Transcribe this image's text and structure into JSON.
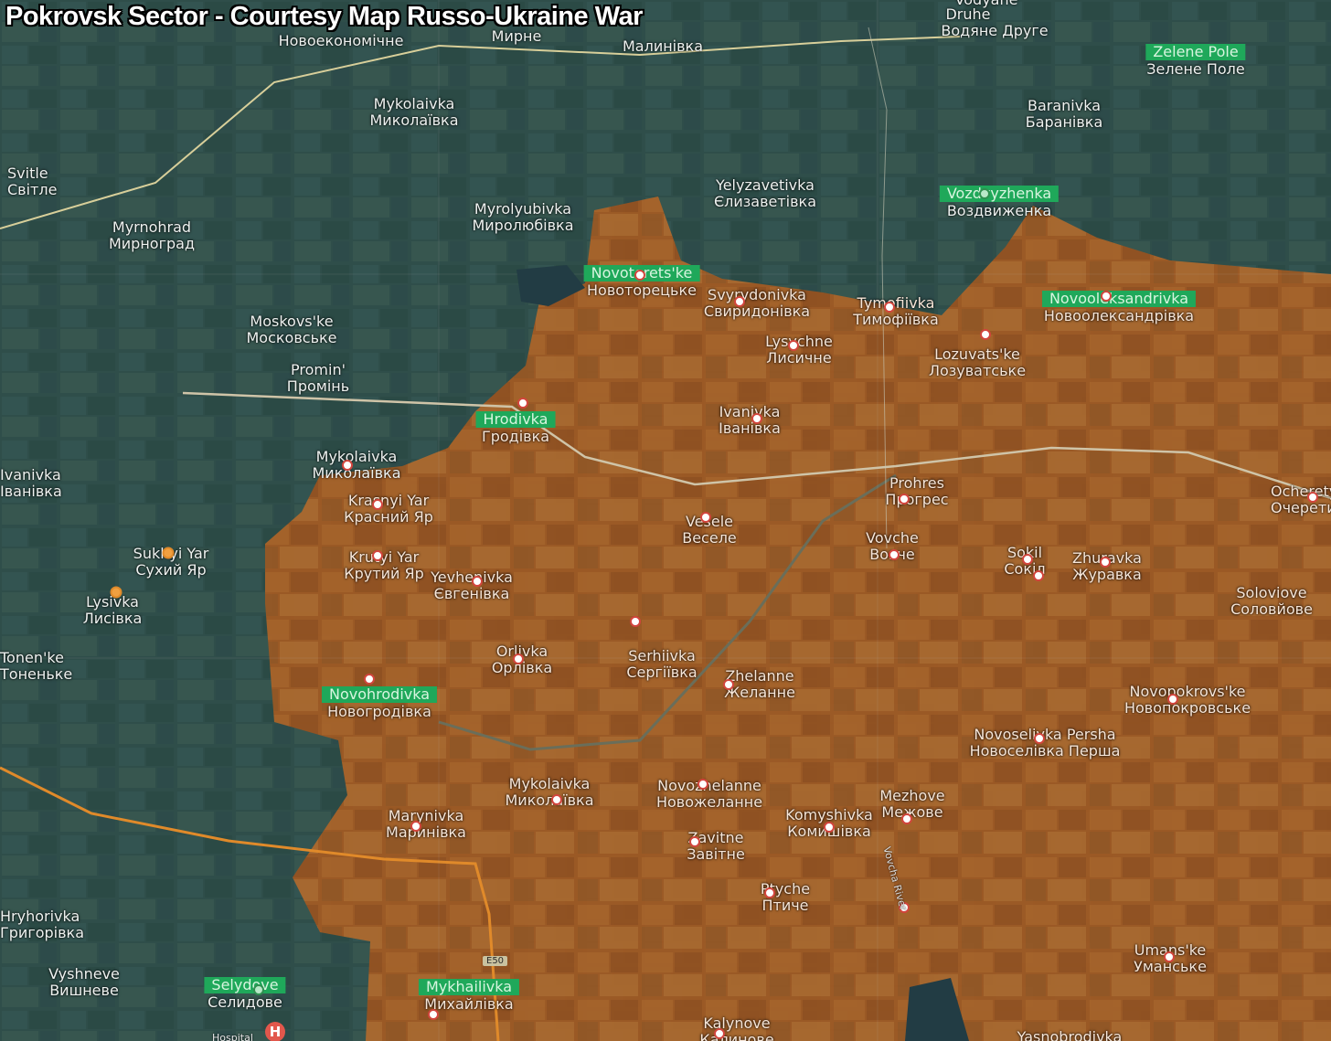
{
  "title": "Pokrovsk Sector - Courtesy Map Russo-Ukraine War",
  "colors": {
    "occupied_overlay": "#c46a1e",
    "ukraine_area": "#2f4f45",
    "highlight_label": "#1fa85a",
    "road_major": "#e9d9a6",
    "road_e50": "#e08a2a"
  },
  "road_shield": "E50",
  "river_label": "Vovcha River",
  "hospital_label": "Hospital",
  "hospital_icon": "hospital-icon",
  "top_cut_labels": [
    "Vodyane",
    "Druhe",
    "Водяне Друге",
    "Малинівка",
    "Новоекономічне",
    "Мирне"
  ],
  "places": [
    {
      "lat": "Zelene Pole",
      "cyr": "Зелене Поле",
      "highlight": true
    },
    {
      "lat": "Baranivka",
      "cyr": "Баранівка"
    },
    {
      "lat": "Mykolaivka",
      "cyr": "Миколаївка"
    },
    {
      "lat": "Svitle",
      "cyr": "Світле"
    },
    {
      "lat": "Myrnohrad",
      "cyr": "Мирноград"
    },
    {
      "lat": "Myrolyubivka",
      "cyr": "Миролюбівка"
    },
    {
      "lat": "Yelyzavetivka",
      "cyr": "Єлизаветівка"
    },
    {
      "lat": "Vozdvyzhenka",
      "cyr": "Воздвиженка",
      "highlight": true
    },
    {
      "lat": "Novotorets'ke",
      "cyr": "Новоторецьке",
      "highlight": true
    },
    {
      "lat": "Svyrydonivka",
      "cyr": "Свиридонівка"
    },
    {
      "lat": "Tymofiivka",
      "cyr": "Тимофіївка"
    },
    {
      "lat": "Novooleksandrivka",
      "cyr": "Новоолександрівка",
      "highlight": true
    },
    {
      "lat": "Moskovs'ke",
      "cyr": "Московське"
    },
    {
      "lat": "Lysychne",
      "cyr": "Лисичне"
    },
    {
      "lat": "Lozuvats'ke",
      "cyr": "Лозуватське"
    },
    {
      "lat": "Promin'",
      "cyr": "Промінь"
    },
    {
      "lat": "Hrodivka",
      "cyr": "Гродівка",
      "highlight": true
    },
    {
      "lat": "Ivanivka",
      "cyr": "Іванівка"
    },
    {
      "lat": "Mykolaivka",
      "cyr": "Миколаївка"
    },
    {
      "lat": "Ivanivka",
      "cyr": "Іванівка"
    },
    {
      "lat": "Prohres",
      "cyr": "Прогрес"
    },
    {
      "lat": "Ocheretyne",
      "cyr": "Очеретине"
    },
    {
      "lat": "Krasnyi Yar",
      "cyr": "Красний Яр"
    },
    {
      "lat": "Vesele",
      "cyr": "Веселе"
    },
    {
      "lat": "Vovche",
      "cyr": "Вовче"
    },
    {
      "lat": "Sukhyi Yar",
      "cyr": "Сухий Яр"
    },
    {
      "lat": "Krutyi Yar",
      "cyr": "Крутий Яр"
    },
    {
      "lat": "Yevhenivka",
      "cyr": "Євгенівка"
    },
    {
      "lat": "Sokil",
      "cyr": "Сокіл"
    },
    {
      "lat": "Zhuravka",
      "cyr": "Журавка"
    },
    {
      "lat": "Lysivka",
      "cyr": "Лисівка"
    },
    {
      "lat": "Soloviove",
      "cyr": "Соловйове"
    },
    {
      "lat": "Orlivka",
      "cyr": "Орлівка"
    },
    {
      "lat": "Serhiivka",
      "cyr": "Сергіївка"
    },
    {
      "lat": "Tonen'ke",
      "cyr": "Тоненьке"
    },
    {
      "lat": "Zhelanne",
      "cyr": "Желанне"
    },
    {
      "lat": "Novohrodivka",
      "cyr": "Новогродівка",
      "highlight": true
    },
    {
      "lat": "Novopokrovs'ke",
      "cyr": "Новопокровське"
    },
    {
      "lat": "Novoselivka Persha",
      "cyr": "Новоселівка Перша"
    },
    {
      "lat": "Mykolaivka",
      "cyr": "Миколаївка"
    },
    {
      "lat": "Novozhelanne",
      "cyr": "Новожеланне"
    },
    {
      "lat": "Mezhove",
      "cyr": "Межове"
    },
    {
      "lat": "Marynivka",
      "cyr": "Маринівка"
    },
    {
      "lat": "Komyshivka",
      "cyr": "Комишівка"
    },
    {
      "lat": "Zavitne",
      "cyr": "Завітне"
    },
    {
      "lat": "Ptyche",
      "cyr": "Птиче"
    },
    {
      "lat": "Hryhorivka",
      "cyr": "Григорівка"
    },
    {
      "lat": "Vyshneve",
      "cyr": "Вишневе"
    },
    {
      "lat": "Selydove",
      "cyr": "Селидове",
      "highlight": true
    },
    {
      "lat": "Mykhailivka",
      "cyr": "Михайлівка",
      "highlight": true
    },
    {
      "lat": "Umans'ke",
      "cyr": "Уманське"
    },
    {
      "lat": "Kalynove",
      "cyr": "Калинове"
    },
    {
      "lat": "Yasnobrodivka",
      "cyr": ""
    }
  ]
}
